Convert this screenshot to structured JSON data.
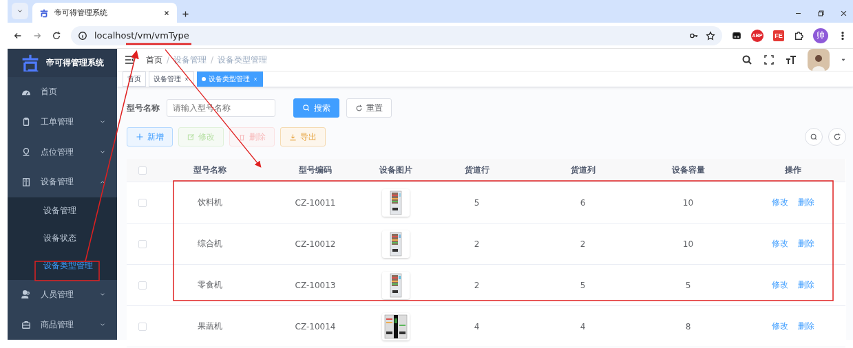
{
  "browser": {
    "tab_title": "帝可得管理系统",
    "url_host": "localhost",
    "url_path": "/vm/vmType",
    "profile": "帅",
    "extensions": [
      "ABP",
      "FE"
    ]
  },
  "sidebar": {
    "title": "帝可得管理系统",
    "items": [
      {
        "label": "首页",
        "selected": false
      },
      {
        "label": "工单管理",
        "expanded": false,
        "selected": false
      },
      {
        "label": "点位管理",
        "expanded": false,
        "selected": false
      },
      {
        "label": "设备管理",
        "expanded": true,
        "selected": false,
        "children": [
          {
            "label": "设备管理",
            "selected": false
          },
          {
            "label": "设备状态",
            "selected": false
          },
          {
            "label": "设备类型管理",
            "selected": true
          }
        ]
      },
      {
        "label": "人员管理",
        "expanded": false,
        "selected": false
      },
      {
        "label": "商品管理",
        "expanded": false,
        "selected": false
      }
    ]
  },
  "breadcrumb": {
    "separator": "/",
    "items": [
      "首页",
      "设备管理",
      "设备类型管理"
    ]
  },
  "tags": [
    {
      "label": "首页",
      "closable": false,
      "selected": false
    },
    {
      "label": "设备管理",
      "closable": true,
      "selected": false
    },
    {
      "label": "设备类型管理",
      "closable": true,
      "selected": true
    }
  ],
  "search": {
    "label": "型号名称",
    "placeholder": "请输入型号名称",
    "search_button": "搜索",
    "reset_button": "重置"
  },
  "toolbar": [
    {
      "label": "新增",
      "kind": "primary",
      "disabled": false
    },
    {
      "label": "修改",
      "kind": "success",
      "disabled": true
    },
    {
      "label": "删除",
      "kind": "danger",
      "disabled": true
    },
    {
      "label": "导出",
      "kind": "warning",
      "disabled": false
    }
  ],
  "table": {
    "select_all_checked": false,
    "columns": [
      "型号名称",
      "型号编码",
      "设备图片",
      "货道行",
      "货道列",
      "设备容量",
      "操作"
    ],
    "rows": [
      {
        "checked": false,
        "name": "饮料机",
        "code": "CZ-10011",
        "image": {
          "kind": "picture"
        },
        "rows": "5",
        "cols": "6",
        "capacity": "10",
        "actions": [
          "修改",
          "删除"
        ]
      },
      {
        "checked": false,
        "name": "综合机",
        "code": "CZ-10012",
        "image": {
          "kind": "picture"
        },
        "rows": "2",
        "cols": "2",
        "capacity": "10",
        "actions": [
          "修改",
          "删除"
        ]
      },
      {
        "checked": false,
        "name": "零食机",
        "code": "CZ-10013",
        "image": {
          "kind": "picture"
        },
        "rows": "2",
        "cols": "5",
        "capacity": "5",
        "actions": [
          "修改",
          "删除"
        ]
      },
      {
        "checked": false,
        "name": "果蔬机",
        "code": "CZ-10014",
        "image": {
          "kind": "picture"
        },
        "rows": "4",
        "cols": "4",
        "capacity": "8",
        "actions": [
          "修改",
          "删除"
        ]
      }
    ]
  }
}
